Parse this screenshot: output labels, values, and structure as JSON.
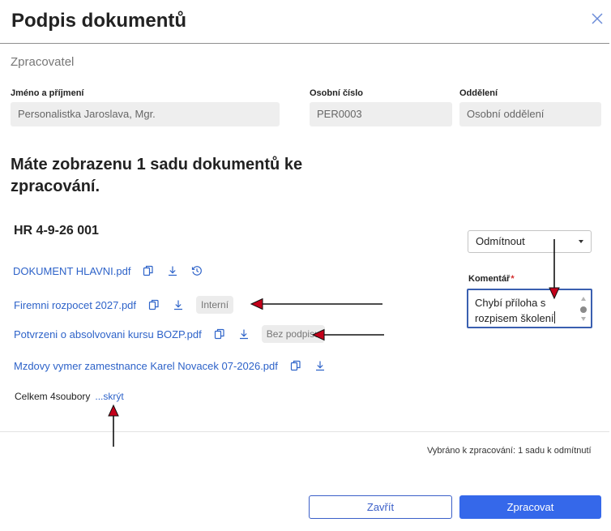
{
  "dialog": {
    "title": "Podpis dokumentů",
    "close_icon": "close-icon"
  },
  "processor": {
    "section_title": "Zpracovatel",
    "fields": [
      {
        "label": "Jméno a příjmení",
        "value": "Personalistka Jaroslava, Mgr."
      },
      {
        "label": "Osobní číslo",
        "value": "PER0003"
      },
      {
        "label": "Oddělení",
        "value": "Osobní oddělení"
      }
    ]
  },
  "headline": "Máte zobrazenu 1 sadu dokumentů ke zpracování.",
  "batch": {
    "title": "HR 4-9-26 001",
    "documents": [
      {
        "name": "DOKUMENT HLAVNI.pdf",
        "icons": [
          "preview-icon",
          "download-icon",
          "history-icon"
        ],
        "badge": ""
      },
      {
        "name": "Firemni rozpocet 2027.pdf",
        "icons": [
          "preview-icon",
          "download-icon"
        ],
        "badge": "Interní"
      },
      {
        "name": "Potvrzeni o absolvovani kursu BOZP.pdf",
        "icons": [
          "preview-icon",
          "download-icon"
        ],
        "badge": "Bez podpisu"
      },
      {
        "name": "Mzdovy vymer zamestnance Karel Novacek 07-2026.pdf",
        "icons": [
          "preview-icon",
          "download-icon"
        ],
        "badge": ""
      }
    ],
    "total_label": "Celkem 4soubory",
    "hide_link": "...skrýt"
  },
  "decision": {
    "selected": "Odmítnout",
    "comment_label": "Komentář",
    "required_mark": "*",
    "comment_value": "Chybí příloha s rozpisem školení"
  },
  "footer": {
    "summary": "Vybráno k zpracování: 1 sadu k odmítnutí",
    "close_label": "Zavřít",
    "process_label": "Zpracovat"
  },
  "colors": {
    "link": "#2e63c9",
    "primary": "#3568ea",
    "annotation_arrow": "#c4001a"
  }
}
